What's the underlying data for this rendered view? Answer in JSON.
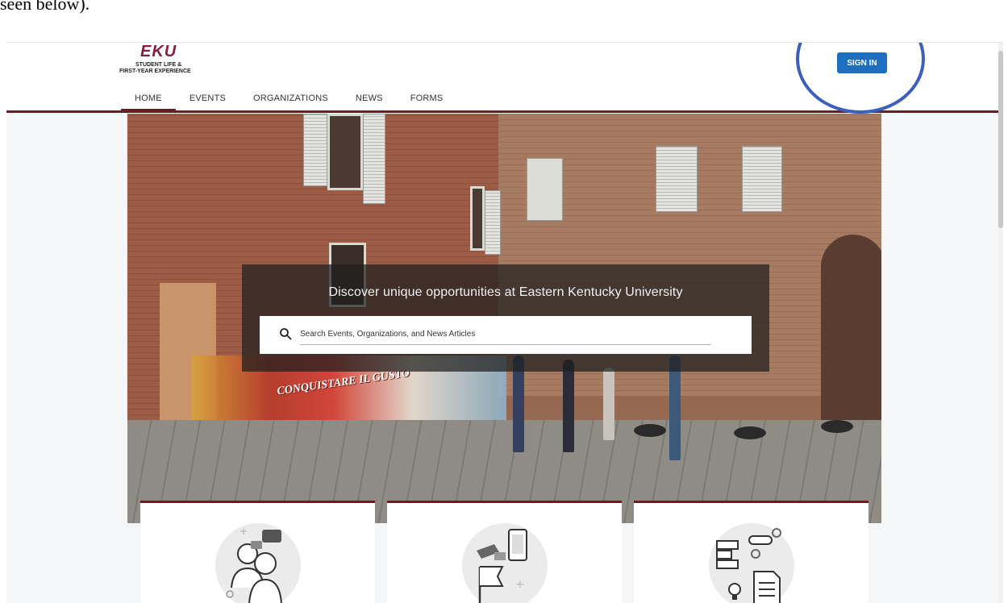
{
  "caption": "seen below).",
  "brand": {
    "logo": "EKU",
    "line1": "STUDENT LIFE &",
    "line2": "FIRST-YEAR EXPERIENCE",
    "accent": "#6e1b24",
    "logo_color": "#861f41"
  },
  "nav": {
    "items": [
      {
        "label": "HOME"
      },
      {
        "label": "EVENTS"
      },
      {
        "label": "ORGANIZATIONS"
      },
      {
        "label": "NEWS"
      },
      {
        "label": "FORMS"
      }
    ],
    "active": "HOME"
  },
  "header": {
    "signin_label": "SIGN IN",
    "signin_color": "#1f6fc1",
    "annotation_color": "#3c5fbd"
  },
  "hero": {
    "heading": "Discover unique opportunities at Eastern Kentucky University",
    "search_placeholder": "Search Events, Organizations, and News Articles",
    "search_value": "",
    "mural_text": "CONQUISTARE IL GUSTO"
  },
  "cards": [
    {
      "icon": "people-chat-icon"
    },
    {
      "icon": "events-flag-phone-icon"
    },
    {
      "icon": "forms-document-icon"
    }
  ]
}
